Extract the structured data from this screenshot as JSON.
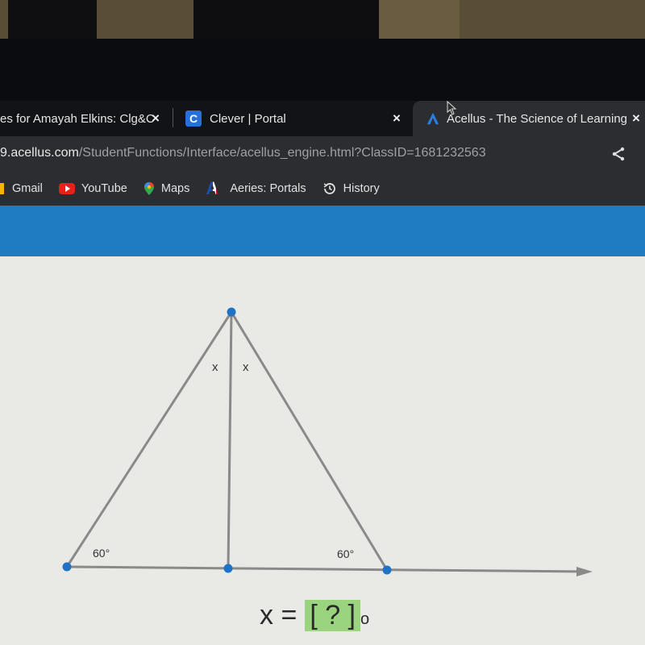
{
  "browser": {
    "tabs": [
      {
        "title": "es for Amayah Elkins: Clg&C",
        "icon": "partial-tab-icon",
        "active": false
      },
      {
        "title": "Clever | Portal",
        "icon": "clever-icon",
        "icon_letter": "C",
        "active": false
      },
      {
        "title": "Acellus - The Science of Learning",
        "icon": "acellus-icon",
        "active": true
      }
    ],
    "close_glyph": "×",
    "url": {
      "host": "9.acellus.com",
      "path": "/StudentFunctions/Interface/acellus_engine.html?ClassID=1681232563"
    },
    "bookmarks": [
      {
        "label": "Gmail",
        "icon": "gmail-icon"
      },
      {
        "label": "YouTube",
        "icon": "youtube-icon"
      },
      {
        "label": "Maps",
        "icon": "maps-icon"
      },
      {
        "label": "Aeries: Portals",
        "icon": "aeries-icon",
        "icon_letter": "A"
      },
      {
        "label": "History",
        "icon": "history-icon"
      }
    ]
  },
  "colors": {
    "banner": "#1f7bc2",
    "point": "#1e73c8",
    "answer_box": "#9ad47f",
    "line": "#8a8a88"
  },
  "problem": {
    "angle_left": "60°",
    "angle_right": "60°",
    "apex_left": "x",
    "apex_right": "x",
    "answer_prefix": "x = ",
    "answer_placeholder": "[ ? ]",
    "answer_suffix": "o"
  }
}
